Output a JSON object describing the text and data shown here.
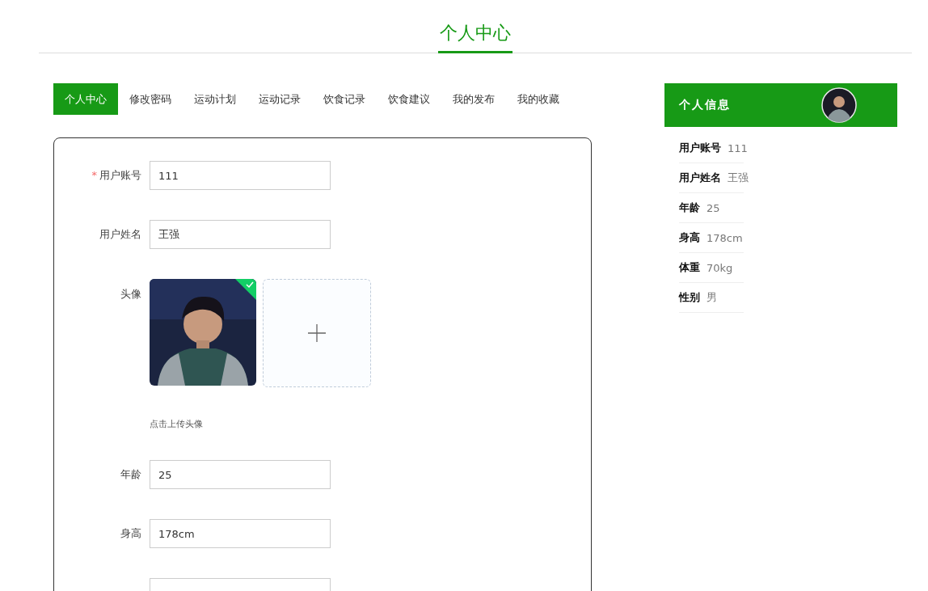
{
  "page_title": "个人中心",
  "tabs": [
    {
      "label": "个人中心",
      "selected": true
    },
    {
      "label": "修改密码",
      "selected": false
    },
    {
      "label": "运动计划",
      "selected": false
    },
    {
      "label": "运动记录",
      "selected": false
    },
    {
      "label": "饮食记录",
      "selected": false
    },
    {
      "label": "饮食建议",
      "selected": false
    },
    {
      "label": "我的发布",
      "selected": false
    },
    {
      "label": "我的收藏",
      "selected": false
    }
  ],
  "form": {
    "fields": [
      {
        "kind": "text",
        "label": "用户账号",
        "required_mark": "*",
        "value": "111"
      },
      {
        "kind": "text",
        "label": "用户姓名",
        "value": "王强"
      },
      {
        "label": "头像",
        "uploaded": true,
        "hint": "点击上传头像"
      },
      {
        "kind": "text",
        "label": "年龄",
        "value": "25"
      },
      {
        "kind": "text",
        "label": "身高",
        "value": "178cm"
      }
    ]
  },
  "profile_card": {
    "title": "个人信息",
    "items": [
      {
        "label": "用户账号",
        "value": "111"
      },
      {
        "label": "用户姓名",
        "value": "王强"
      },
      {
        "label": "年龄",
        "value": "25"
      },
      {
        "label": "身高",
        "value": "178cm"
      },
      {
        "label": "体重",
        "value": "70kg"
      },
      {
        "label": "性别",
        "value": "男"
      }
    ]
  }
}
